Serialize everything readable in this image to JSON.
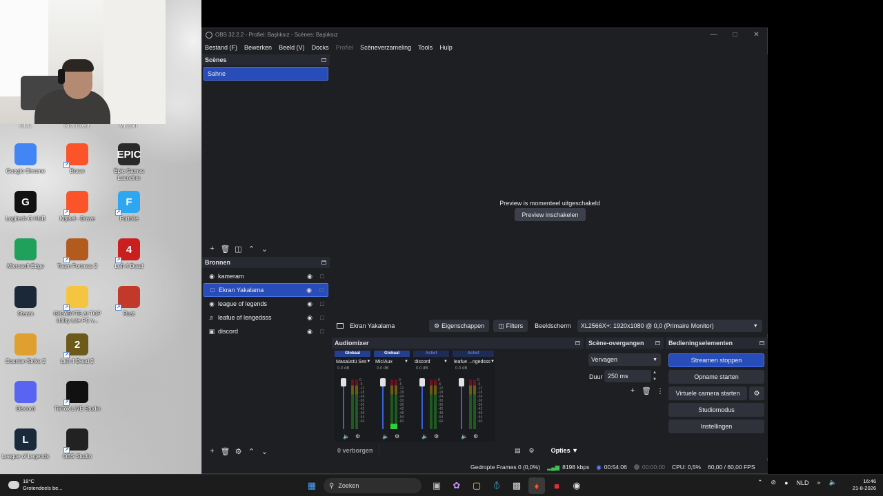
{
  "desktop": {
    "partial_labels": [
      "GUC",
      "Riot Client",
      "Mr.Zivir"
    ],
    "icons": [
      {
        "label": "Google Chrome",
        "icon": "chrome-icon",
        "color": "#4285f4"
      },
      {
        "label": "Brave",
        "icon": "brave-icon",
        "color": "#fb542b"
      },
      {
        "label": "Epic Games Launcher",
        "icon": "epic-games-icon",
        "color": "#2a2a2a",
        "glyph": "EPIC"
      },
      {
        "label": "Logitech G HUB",
        "icon": "logitech-icon",
        "color": "#111111",
        "glyph": "G"
      },
      {
        "label": "Kişisel - Brave",
        "icon": "brave-profile-icon",
        "color": "#fb542b"
      },
      {
        "label": "Fortnite",
        "icon": "fortnite-icon",
        "color": "#2ea7f0",
        "glyph": "F"
      },
      {
        "label": "Microsoft Edge",
        "icon": "edge-icon",
        "color": "#1fa05b"
      },
      {
        "label": "Team Fortress 2",
        "icon": "tf2-icon",
        "color": "#b35a1f"
      },
      {
        "label": "Left 4 Dead",
        "icon": "left4dead-icon",
        "color": "#c91f1f",
        "glyph": "4"
      },
      {
        "label": "Steam",
        "icon": "steam-icon",
        "color": "#1b2838"
      },
      {
        "label": "GIGABYTE AI TOP Utility Lite PC v...",
        "icon": "folder-icon",
        "color": "#f5c542"
      },
      {
        "label": "Rust",
        "icon": "rust-icon",
        "color": "#c0392b"
      },
      {
        "label": "Counter-Strike 2",
        "icon": "cs2-icon",
        "color": "#e0a030"
      },
      {
        "label": "Left 4 Dead 2",
        "icon": "left4dead2-icon",
        "color": "#6b5a1a",
        "glyph": "2"
      },
      {
        "label": "",
        "icon": "empty",
        "color": ""
      },
      {
        "label": "Discord",
        "icon": "discord-icon",
        "color": "#5865f2"
      },
      {
        "label": "TikTok LIVE Studio",
        "icon": "tiktok-icon",
        "color": "#111111"
      },
      {
        "label": "",
        "icon": "empty",
        "color": ""
      },
      {
        "label": "League of Legends",
        "icon": "lol-icon",
        "color": "#1a2a3a",
        "glyph": "L"
      },
      {
        "label": "OBS Studio",
        "icon": "obs-icon",
        "color": "#222222"
      }
    ]
  },
  "obs": {
    "title": "OBS 32.2.2 - Profiel: Başlıksız - Scènes: Başlıksız",
    "menu": [
      {
        "label": "Bestand (F)",
        "disabled": false
      },
      {
        "label": "Bewerken",
        "disabled": false
      },
      {
        "label": "Beeld (V)",
        "disabled": false
      },
      {
        "label": "Docks",
        "disabled": false
      },
      {
        "label": "Profiel",
        "disabled": true
      },
      {
        "label": "Scèneverzameling",
        "disabled": false
      },
      {
        "label": "Tools",
        "disabled": false
      },
      {
        "label": "Hulp",
        "disabled": false
      }
    ],
    "scenes": {
      "title": "Scènes",
      "items": [
        "Sahne"
      ]
    },
    "sources": {
      "title": "Bronnen",
      "items": [
        {
          "name": "kameram",
          "icon": "camera-icon",
          "selected": false
        },
        {
          "name": "Ekran Yakalama",
          "icon": "monitor-icon",
          "selected": true
        },
        {
          "name": "league of legends",
          "icon": "gamepad-icon",
          "selected": false
        },
        {
          "name": "leafue of lengedsss",
          "icon": "speaker-icon",
          "selected": false
        },
        {
          "name": "discord",
          "icon": "window-icon",
          "selected": false
        }
      ]
    },
    "preview": {
      "message": "Preview is momenteel uitgeschakeld",
      "button": "Preview inschakelen"
    },
    "context_bar": {
      "source_name": "Ekran Yakalama",
      "properties": "Eigenschappen",
      "filters": "Filters",
      "monitor_label": "Beeldscherm",
      "monitor_value": "XL2566X+: 1920x1080 @ 0,0 (Primaire Monitor)"
    },
    "audio_mixer": {
      "title": "Audiomixer",
      "channels": [
        {
          "tag": "Globaal",
          "name": "Masaüstü Ses",
          "db": "0.0 dB",
          "active": false
        },
        {
          "tag": "Globaal",
          "name": "Mic/Aux",
          "db": "0.0 dB",
          "active": false
        },
        {
          "tag": "Actief",
          "name": "discord",
          "db": "0.0 dB",
          "active": true
        },
        {
          "tag": "Actief",
          "name": "leafue ...ngedsss",
          "db": "0.0 dB",
          "active": true
        }
      ],
      "scale": [
        "0",
        "-6",
        "-12",
        "-18",
        "-24",
        "-30",
        "-36",
        "-42",
        "-48",
        "-54",
        "-60"
      ],
      "hidden": "0 verborgen",
      "options": "Opties"
    },
    "transitions": {
      "title": "Scène-overgangen",
      "selected": "Vervagen",
      "duration_label": "Duur",
      "duration_value": "250 ms"
    },
    "controls": {
      "title": "Bedieningselementen",
      "stream": "Streamen stoppen",
      "record": "Opname starten",
      "virtual_cam": "Virtuele camera starten",
      "studio": "Studiomodus",
      "settings": "Instellingen"
    },
    "status": {
      "dropped": "Gedropte Frames 0 (0,0%)",
      "bitrate": "8198 kbps",
      "stream_time": "00:54:06",
      "rec_time": "00:00:00",
      "cpu": "CPU: 0,5%",
      "fps": "60,00 / 60,00 FPS"
    }
  },
  "taskbar": {
    "weather_temp": "18°C",
    "weather_desc": "Grotendeels be...",
    "search": "Zoeken",
    "language": "NLD",
    "time": "16:46",
    "date": "21-8-2026"
  }
}
